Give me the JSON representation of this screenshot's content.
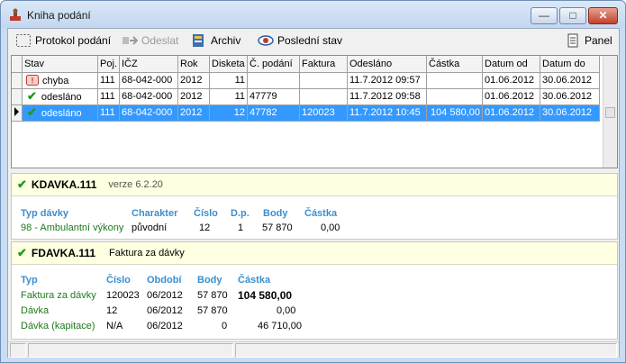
{
  "window": {
    "title": "Kniha podání",
    "controls": {
      "minimize": "—",
      "maximize": "□",
      "close": "✕"
    }
  },
  "toolbar": {
    "protokol": "Protokol podání",
    "odeslat": "Odeslat",
    "archiv": "Archiv",
    "posledni": "Poslední stav",
    "panel": "Panel"
  },
  "grid": {
    "columns": [
      "Stav",
      "Poj.",
      "IČZ",
      "Rok",
      "Disketa",
      "Č. podání",
      "Faktura",
      "Odesláno",
      "Částka",
      "Datum od",
      "Datum do"
    ],
    "rows": [
      {
        "stav": "chyba",
        "poj": "111",
        "icz": "68-042-000",
        "rok": "2012",
        "disketa": "11",
        "podani": "",
        "faktura": "",
        "odeslano": "11.7.2012 09:57",
        "castka": "",
        "od": "01.06.2012",
        "do": "30.06.2012"
      },
      {
        "stav": "odesláno",
        "poj": "111",
        "icz": "68-042-000",
        "rok": "2012",
        "disketa": "11",
        "podani": "47779",
        "faktura": "",
        "odeslano": "11.7.2012 09:58",
        "castka": "",
        "od": "01.06.2012",
        "do": "30.06.2012"
      },
      {
        "stav": "odesláno",
        "poj": "111",
        "icz": "68-042-000",
        "rok": "2012",
        "disketa": "12",
        "podani": "47782",
        "faktura": "120023",
        "odeslano": "11.7.2012 10:45",
        "castka": "104 580,00",
        "od": "01.06.2012",
        "do": "30.06.2012"
      }
    ]
  },
  "kdavka": {
    "name": "KDAVKA.111",
    "version": "verze 6.2.20",
    "headers": {
      "typ": "Typ dávky",
      "charakter": "Charakter",
      "cislo": "Číslo",
      "dp": "D.p.",
      "body": "Body",
      "castka": "Částka"
    },
    "row": {
      "typ": "98 - Ambulantní výkony",
      "charakter": "původní",
      "cislo": "12",
      "dp": "1",
      "body": "57 870",
      "castka": "0,00"
    }
  },
  "fdavka": {
    "name": "FDAVKA.111",
    "subtitle": "Faktura za dávky",
    "headers": {
      "typ": "Typ",
      "cislo": "Číslo",
      "obdobi": "Období",
      "body": "Body",
      "castka": "Částka"
    },
    "rows": [
      {
        "typ": "Faktura za dávky",
        "cislo": "120023",
        "obdobi": "06/2012",
        "body": "57 870",
        "castka": "104 580,00"
      },
      {
        "typ": "Dávka",
        "cislo": "12",
        "obdobi": "06/2012",
        "body": "57 870",
        "castka": "0,00"
      },
      {
        "typ": "Dávka (kapitace)",
        "cislo": "N/A",
        "obdobi": "06/2012",
        "body": "0",
        "castka": "46 710,00"
      }
    ]
  },
  "icons": {
    "app": "stamp-icon",
    "protokol": "dotted-frame-icon",
    "odeslat": "send-icon",
    "archiv": "archive-icon",
    "posledni": "eye-icon",
    "panel": "panel-icon",
    "error": "error-icon",
    "ok": "check-icon",
    "row_pointer": "row-pointer-icon"
  },
  "colors": {
    "selection": "#3399ff",
    "header_blue": "#3a8fd0",
    "link_green": "#1c7a1c",
    "info_bg": "#ffffe1"
  }
}
